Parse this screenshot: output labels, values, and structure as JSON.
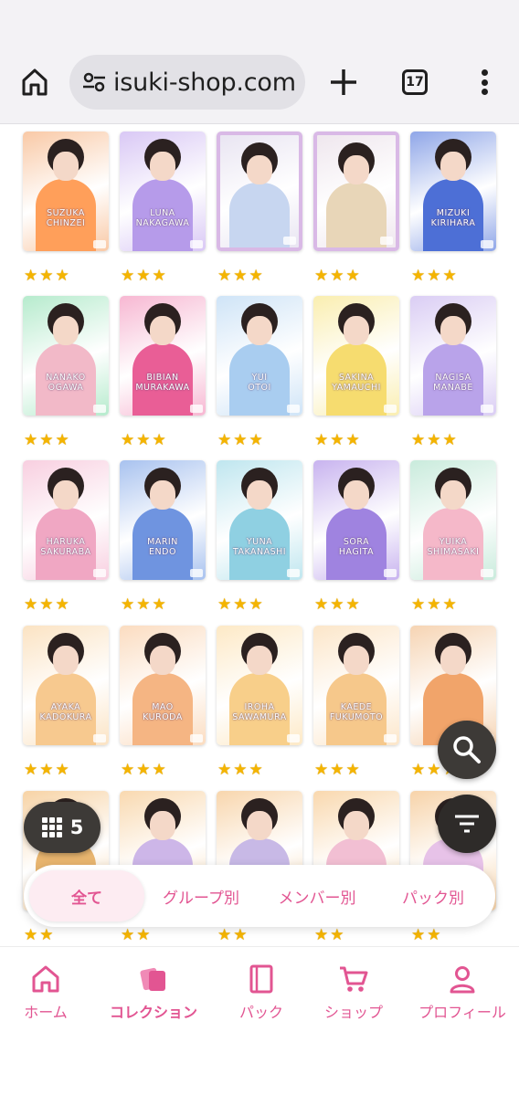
{
  "browser": {
    "url": "isuki-shop.com",
    "tab_count": "17"
  },
  "cards": [
    {
      "name": "SUZUKA\nCHINZEI",
      "bg": "#f9c9a6",
      "accent": "#ff9f5a",
      "stars": 3
    },
    {
      "name": "LUNA\nNAKAGAWA",
      "bg": "#d9c8f5",
      "accent": "#b69bea",
      "stars": 3
    },
    {
      "name": "",
      "bg": "#e9e5f2",
      "accent": "#c7d6f0",
      "stars": 3,
      "framed": true
    },
    {
      "name": "",
      "bg": "#efe7ee",
      "accent": "#e8d6b8",
      "stars": 3,
      "framed": true
    },
    {
      "name": "MIZUKI\nKIRIHARA",
      "bg": "#8fa6e8",
      "accent": "#4d6fd6",
      "stars": 3
    },
    {
      "name": "NANAKO\nOGAWA",
      "bg": "#b6ebcd",
      "accent": "#f2b9c8",
      "stars": 3
    },
    {
      "name": "BIBIAN\nMURAKAWA",
      "bg": "#f7b7d2",
      "accent": "#e95e96",
      "stars": 3
    },
    {
      "name": "YUI\nOTOI",
      "bg": "#cfe4f7",
      "accent": "#a9cdf0",
      "stars": 3
    },
    {
      "name": "SAKINA\nYAMAUCHI",
      "bg": "#faeeb0",
      "accent": "#f6dc6f",
      "stars": 3
    },
    {
      "name": "NAGISA\nMANABE",
      "bg": "#dacdf4",
      "accent": "#b9a3ea",
      "stars": 3
    },
    {
      "name": "HARUKA\nSAKURABA",
      "bg": "#f8cfe0",
      "accent": "#f0a7c3",
      "stars": 3
    },
    {
      "name": "MARIN\nENDO",
      "bg": "#a8c2ef",
      "accent": "#6f94e0",
      "stars": 3
    },
    {
      "name": "YUNA\nTAKANASHI",
      "bg": "#bfe6ef",
      "accent": "#8fd0e2",
      "stars": 3
    },
    {
      "name": "SORA\nHAGITA",
      "bg": "#c8b3ef",
      "accent": "#9f83e0",
      "stars": 3
    },
    {
      "name": "YUIKA\nSHIMASAKI",
      "bg": "#c9ebdc",
      "accent": "#f5b8c9",
      "stars": 3
    },
    {
      "name": "AYAKA\nKADOKURA",
      "bg": "#fbe3c3",
      "accent": "#f7c98f",
      "stars": 3
    },
    {
      "name": "MAO\nKURODA",
      "bg": "#fbdcc0",
      "accent": "#f5b583",
      "stars": 3
    },
    {
      "name": "IROHA\nSAWAMURA",
      "bg": "#fde9c6",
      "accent": "#f8cf8a",
      "stars": 3
    },
    {
      "name": "KAEDE\nFUKUMOTO",
      "bg": "#fce6c9",
      "accent": "#f6c88b",
      "stars": 3
    },
    {
      "name": "",
      "bg": "#f6d4b3",
      "accent": "#f1a46a",
      "stars": 3
    },
    {
      "name": "",
      "bg": "#f7d3a5",
      "accent": "#e8b56f",
      "stars": 2
    },
    {
      "name": "",
      "bg": "#f9d9b0",
      "accent": "#cdb6e8",
      "stars": 2
    },
    {
      "name": "",
      "bg": "#f8d6ad",
      "accent": "#c8b9e6",
      "stars": 2
    },
    {
      "name": "",
      "bg": "#f9d8ae",
      "accent": "#f2bfd3",
      "stars": 2
    },
    {
      "name": "",
      "bg": "#f7d3a9",
      "accent": "#e7c2e8",
      "stars": 2
    }
  ],
  "grid_toggle": {
    "count": "5"
  },
  "segments": {
    "all": "全て",
    "group": "グループ別",
    "member": "メンバー別",
    "pack": "パック別"
  },
  "nav": {
    "home": "ホーム",
    "collection": "コレクション",
    "pack": "パック",
    "shop": "ショップ",
    "profile": "プロフィール"
  },
  "colors": {
    "accent": "#e25592",
    "star": "#f4b400",
    "fab": "#3d3a37"
  }
}
